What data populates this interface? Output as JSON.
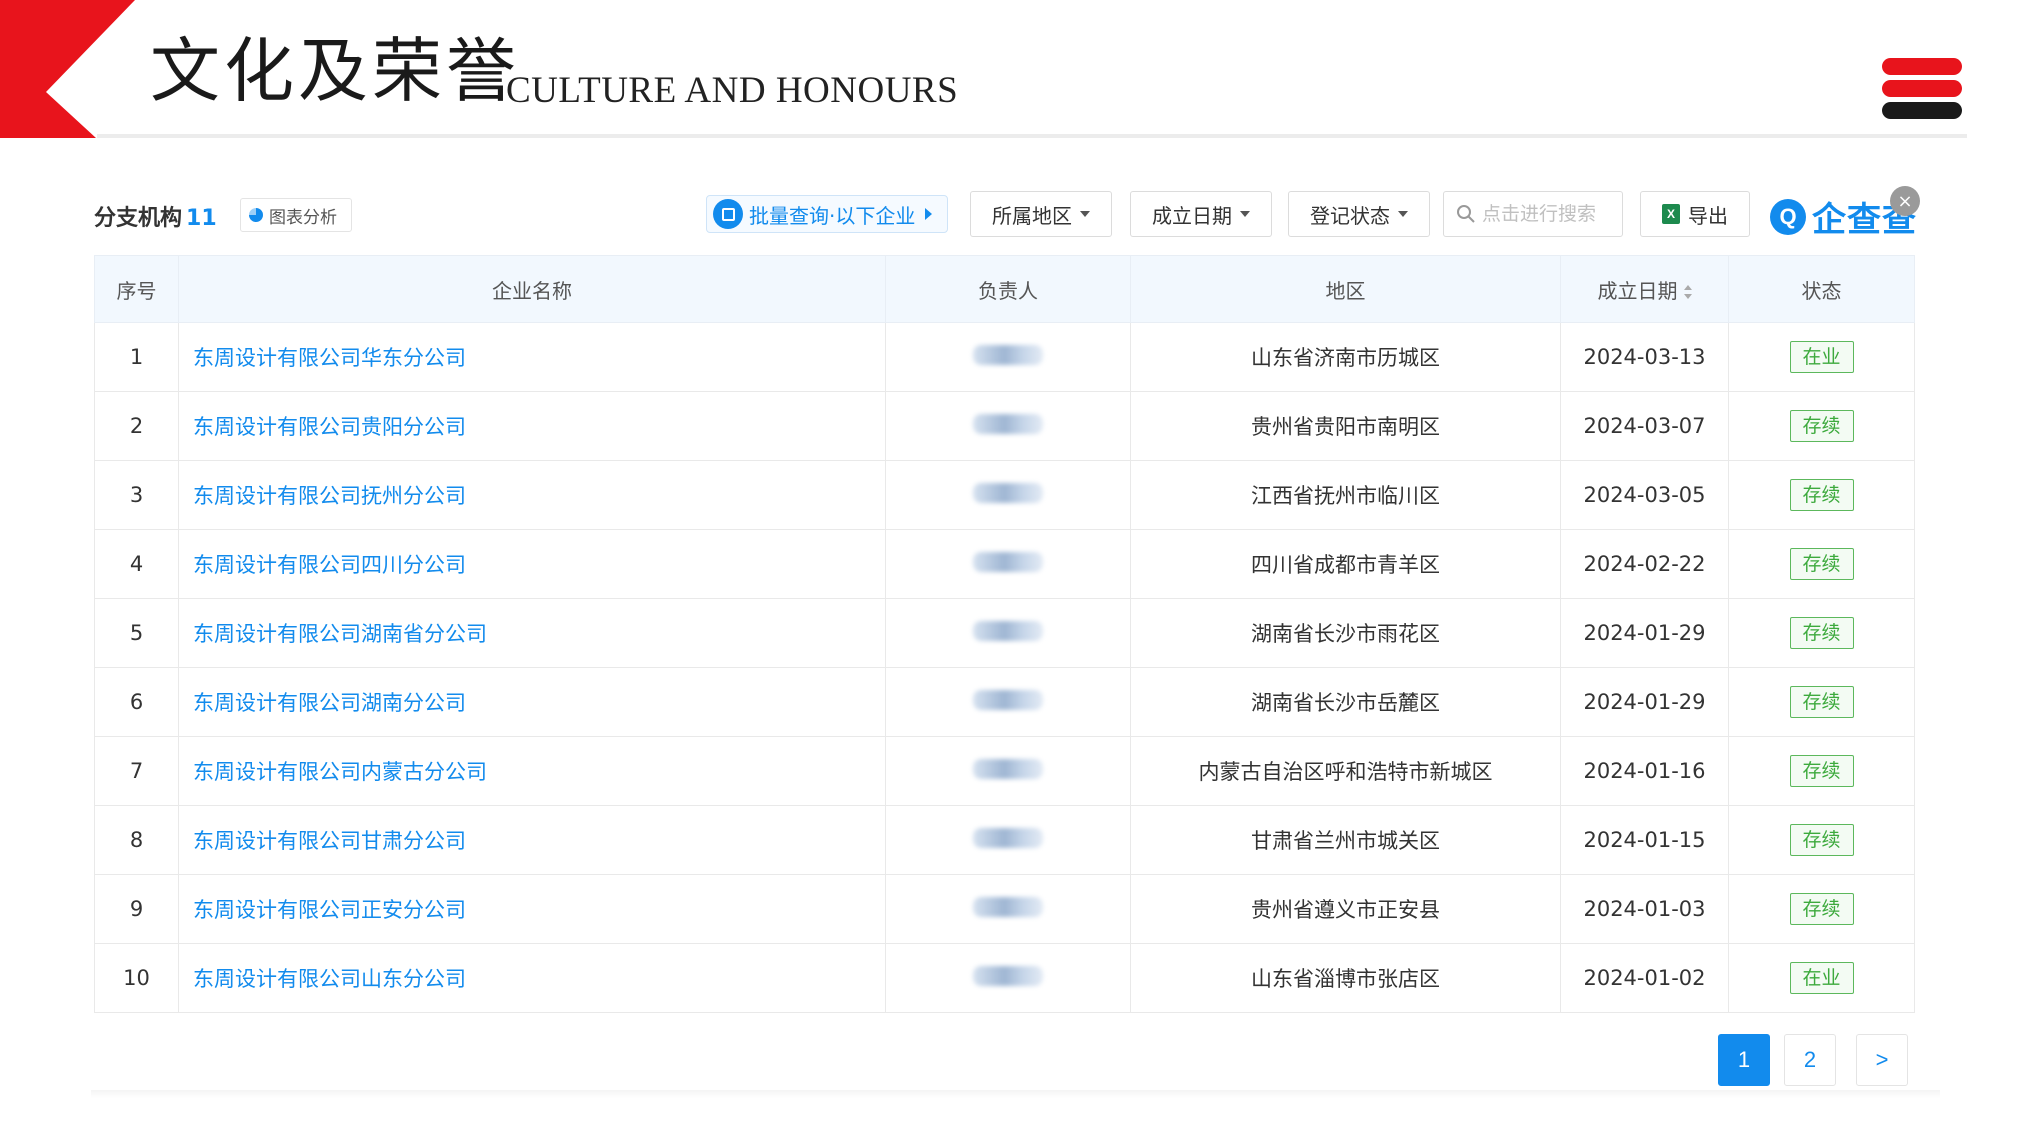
{
  "header": {
    "title_cn": "文化及荣誉",
    "title_en": "CULTURE AND HONOURS",
    "accent_color": "#e8141c"
  },
  "toolbar": {
    "title": "分支机构",
    "count": "11",
    "chart_label": "图表分析",
    "batch_label": "批量查询·以下企业",
    "filters": [
      "所属地区",
      "成立日期",
      "登记状态"
    ],
    "search_placeholder": "点击进行搜索",
    "export_label": "导出",
    "brand": "企查查"
  },
  "table": {
    "columns": [
      "序号",
      "企业名称",
      "负责人",
      "地区",
      "成立日期",
      "状态"
    ],
    "rows": [
      {
        "no": "1",
        "name": "东周设计有限公司华东分公司",
        "region": "山东省济南市历城区",
        "date": "2024-03-13",
        "status": "在业"
      },
      {
        "no": "2",
        "name": "东周设计有限公司贵阳分公司",
        "region": "贵州省贵阳市南明区",
        "date": "2024-03-07",
        "status": "存续"
      },
      {
        "no": "3",
        "name": "东周设计有限公司抚州分公司",
        "region": "江西省抚州市临川区",
        "date": "2024-03-05",
        "status": "存续"
      },
      {
        "no": "4",
        "name": "东周设计有限公司四川分公司",
        "region": "四川省成都市青羊区",
        "date": "2024-02-22",
        "status": "存续"
      },
      {
        "no": "5",
        "name": "东周设计有限公司湖南省分公司",
        "region": "湖南省长沙市雨花区",
        "date": "2024-01-29",
        "status": "存续"
      },
      {
        "no": "6",
        "name": "东周设计有限公司湖南分公司",
        "region": "湖南省长沙市岳麓区",
        "date": "2024-01-29",
        "status": "存续"
      },
      {
        "no": "7",
        "name": "东周设计有限公司内蒙古分公司",
        "region": "内蒙古自治区呼和浩特市新城区",
        "date": "2024-01-16",
        "status": "存续"
      },
      {
        "no": "8",
        "name": "东周设计有限公司甘肃分公司",
        "region": "甘肃省兰州市城关区",
        "date": "2024-01-15",
        "status": "存续"
      },
      {
        "no": "9",
        "name": "东周设计有限公司正安分公司",
        "region": "贵州省遵义市正安县",
        "date": "2024-01-03",
        "status": "存续"
      },
      {
        "no": "10",
        "name": "东周设计有限公司山东分公司",
        "region": "山东省淄博市张店区",
        "date": "2024-01-02",
        "status": "在业"
      }
    ]
  },
  "pagination": {
    "pages": [
      "1",
      "2"
    ],
    "next": ">",
    "current": "1"
  }
}
